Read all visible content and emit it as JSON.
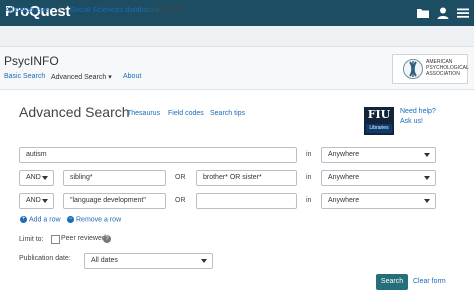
{
  "header": {
    "logo": "ProQuest",
    "icons": [
      "folder-icon",
      "user-icon",
      "menu-icon"
    ]
  },
  "breadcrumb": {
    "items": [
      "All databases",
      "Social Sciences databases",
      "PsycINFO"
    ],
    "separator": "›"
  },
  "database": {
    "name": "PsycINFO",
    "nav": [
      "Basic Search",
      "Advanced Search ▾",
      "About"
    ],
    "publisher_logo_text": "AMERICAN PSYCHOLOGICAL ASSOCIATION"
  },
  "search": {
    "title": "Advanced Search",
    "links": [
      "Thesaurus",
      "Field codes",
      "Search tips"
    ],
    "library_logo": {
      "top": "FIU",
      "bottom": "Libraries"
    },
    "help": {
      "need_help": "Need help?",
      "ask_us": "Ask us!"
    },
    "rows": [
      {
        "operator": "",
        "term": "autism",
        "field": "Anywhere"
      },
      {
        "operator": "AND",
        "term": "sibling*",
        "or_term": "brother* OR sister*",
        "field": "Anywhere"
      },
      {
        "operator": "AND",
        "term": "\"language development\"",
        "or_term": "",
        "field": "Anywhere"
      }
    ],
    "or_label": "OR",
    "in_label": "in",
    "add_row": "Add a row",
    "remove_row": "Remove a row",
    "limit_to": "Limit to:",
    "peer_reviewed": "Peer reviewed",
    "peer_reviewed_checked": false,
    "publication_date_label": "Publication date:",
    "publication_date_value": "All dates",
    "search_button": "Search",
    "clear_form": "Clear form"
  },
  "colors": {
    "topbar": "#1c4d63",
    "link": "#1a6bb8",
    "button": "#246f79"
  }
}
